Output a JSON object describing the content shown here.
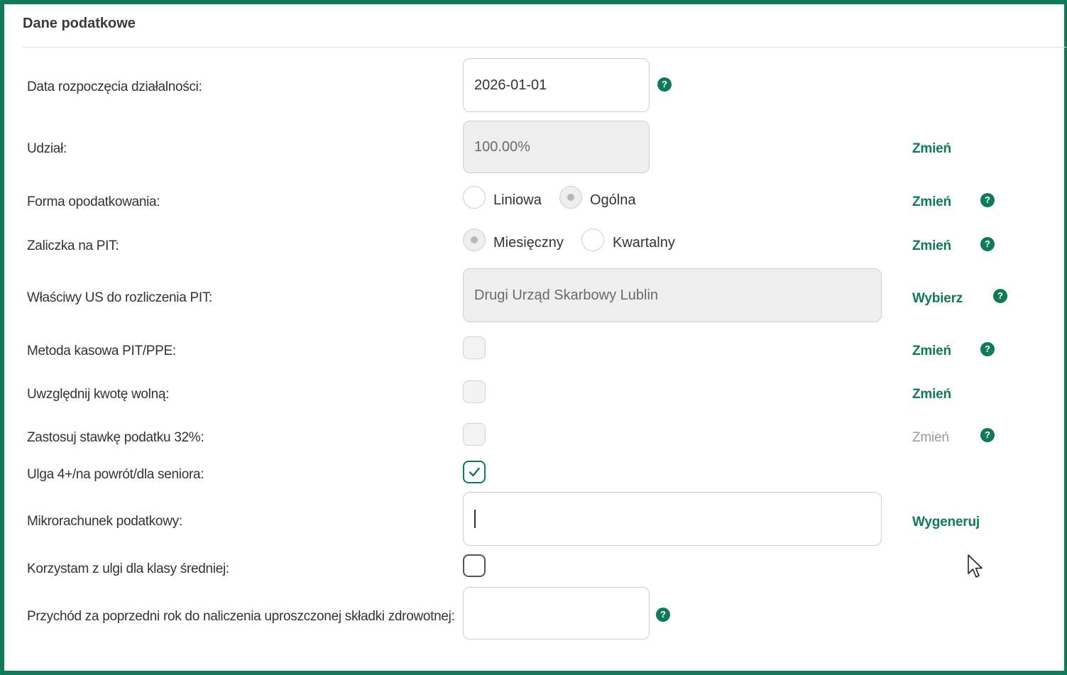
{
  "panel": {
    "title": "Dane podatkowe"
  },
  "rows": {
    "start_date": {
      "label": "Data rozpoczęcia działalności:",
      "value": "2026-01-01",
      "help": "?"
    },
    "share": {
      "label": "Udział:",
      "value": "100.00%",
      "action": "Zmień"
    },
    "tax_form": {
      "label": "Forma opodatkowania:",
      "options": [
        "Liniowa",
        "Ogólna"
      ],
      "selected": "Ogólna",
      "action": "Zmień",
      "help": "?"
    },
    "pit_advance": {
      "label": "Zaliczka na PIT:",
      "options": [
        "Miesięczny",
        "Kwartalny"
      ],
      "selected": "Miesięczny",
      "action": "Zmień",
      "help": "?"
    },
    "tax_office": {
      "label": "Właściwy US do rozliczenia PIT:",
      "value": "Drugi Urząd Skarbowy Lublin",
      "action": "Wybierz",
      "help": "?"
    },
    "cash_method": {
      "label": "Metoda kasowa PIT/PPE:",
      "checked": false,
      "action": "Zmień",
      "help": "?"
    },
    "tax_free": {
      "label": "Uwzględnij kwotę wolną:",
      "checked": false,
      "action": "Zmień"
    },
    "rate_32": {
      "label": "Zastosuj stawkę podatku 32%:",
      "checked": false,
      "action": "Zmień",
      "help": "?"
    },
    "relief_4plus": {
      "label": "Ulga 4+/na powrót/dla seniora:",
      "checked": true
    },
    "micro_account": {
      "label": "Mikrorachunek podatkowy:",
      "value": "",
      "action": "Wygeneruj"
    },
    "middle_class": {
      "label": "Korzystam z ulgi dla klasy średniej:",
      "checked": false
    },
    "prev_income": {
      "label": "Przychód za poprzedni rok do naliczenia uproszczonej składki zdrowotnej:",
      "value": "",
      "help": "?"
    }
  },
  "colors": {
    "accent": "#0f7a5a",
    "border": "#cfcfcf",
    "disabled_bg": "#eeeeee"
  }
}
